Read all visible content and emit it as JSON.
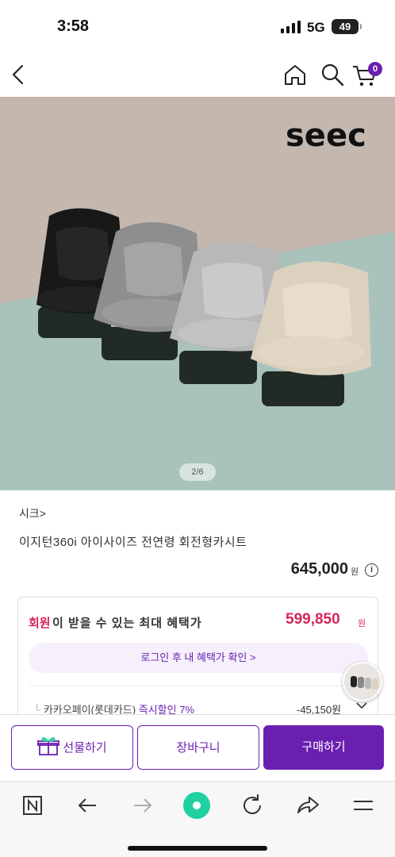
{
  "status_bar": {
    "time": "3:58",
    "network": "5G",
    "battery": "49"
  },
  "nav": {
    "cart_count": "0"
  },
  "hero": {
    "logo_text": "seec",
    "pager": "2/6"
  },
  "product": {
    "brand": "시크>",
    "name": "이지턴360i 아이사이즈 전연령 회전형카시트",
    "price": "645,000",
    "price_unit": "원"
  },
  "benefits": {
    "member_word": "회원",
    "title_rest": "이 받을 수 있는 최대 혜택가",
    "best_price": "599,850",
    "best_price_unit": "원",
    "login_prompt": "로그인 후 내 혜택가 확인 >",
    "discount_label": "카카오페이(롯데카드) ",
    "discount_highlight": "즉시할인 7%",
    "discount_amount": "-45,150원"
  },
  "actions": {
    "gift": "선물하기",
    "cart": "장바구니",
    "buy": "구매하기"
  },
  "colors": {
    "accent": "#6b1fb0",
    "sale": "#d8265a",
    "hero_top": "#c4b7ae",
    "hero_bottom": "#a9c3bc"
  }
}
